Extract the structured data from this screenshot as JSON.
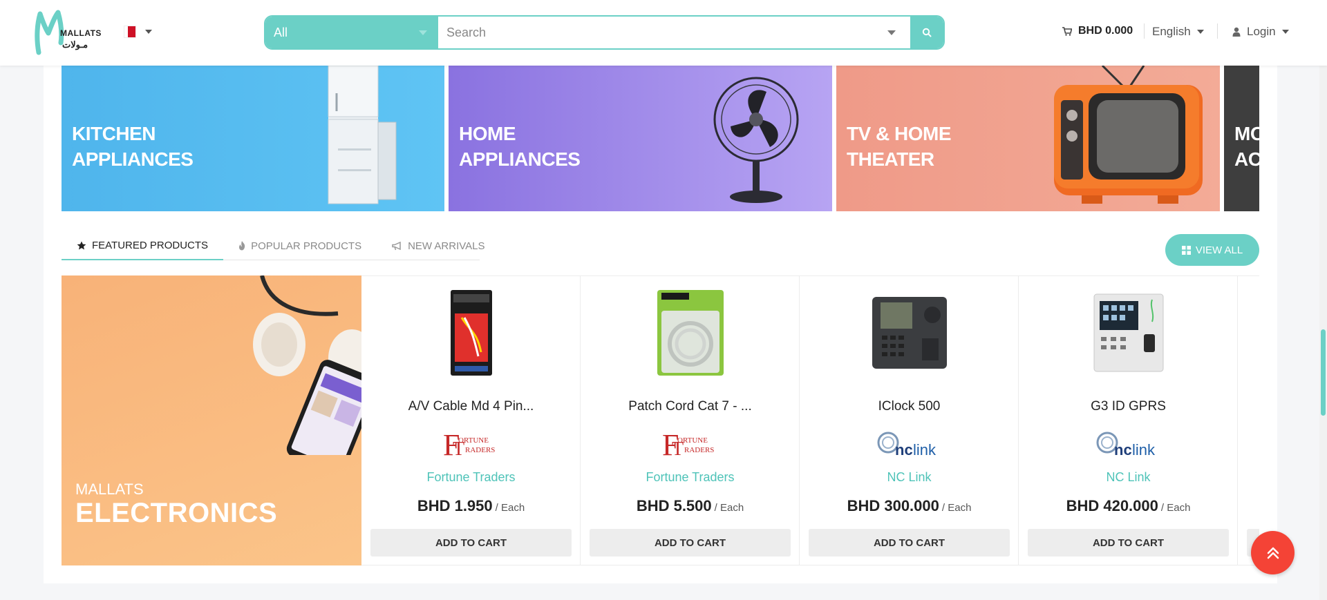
{
  "header": {
    "logo_en": "MALLATS",
    "logo_ar": "مـولات",
    "country": "Bahrain",
    "search": {
      "category": "All",
      "placeholder": "Search"
    },
    "cart_total": "BHD 0.000",
    "language": "English",
    "login": "Login"
  },
  "categories": [
    {
      "line1": "KITCHEN",
      "line2": "APPLIANCES"
    },
    {
      "line1": "HOME",
      "line2": "APPLIANCES"
    },
    {
      "line1": "TV & HOME",
      "line2": "THEATER"
    },
    {
      "line1": "MO",
      "line2": "AC"
    }
  ],
  "tabs": [
    {
      "label": "FEATURED PRODUCTS",
      "icon": "star-icon"
    },
    {
      "label": "POPULAR PRODUCTS",
      "icon": "fire-icon"
    },
    {
      "label": "NEW ARRIVALS",
      "icon": "megaphone-icon"
    }
  ],
  "view_all": "VIEW ALL",
  "promo": {
    "small": "MALLATS",
    "big": "ELECTRONICS"
  },
  "products": [
    {
      "name": "A/V Cable Md 4 Pin...",
      "vendor": "Fortune Traders",
      "vendor_logo_line1": "ORTUNE",
      "vendor_logo_line2": "RADERS",
      "price": "BHD 1.950",
      "unit": "/ Each",
      "add": "ADD TO CART",
      "image": "av-cable-package"
    },
    {
      "name": "Patch Cord Cat 7 - ...",
      "vendor": "Fortune Traders",
      "vendor_logo_line1": "ORTUNE",
      "vendor_logo_line2": "RADERS",
      "price": "BHD 5.500",
      "unit": "/ Each",
      "add": "ADD TO CART",
      "image": "patch-cord-package"
    },
    {
      "name": "IClock 500",
      "vendor": "NC Link",
      "vendor_logo_line1": "nc",
      "vendor_logo_line2": "link",
      "price": "BHD 300.000",
      "unit": "/ Each",
      "add": "ADD TO CART",
      "image": "time-clock-device"
    },
    {
      "name": "G3 ID GPRS",
      "vendor": "NC Link",
      "vendor_logo_line1": "nc",
      "vendor_logo_line2": "link",
      "price": "BHD 420.000",
      "unit": "/ Each",
      "add": "ADD TO CART",
      "image": "fingerprint-terminal"
    }
  ],
  "colors": {
    "accent": "#6bd0c6",
    "vendor_link": "#4ec3b8",
    "to_top": "#f44336"
  }
}
